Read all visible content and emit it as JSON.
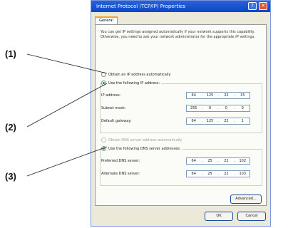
{
  "callouts": [
    "(1)",
    "(2)",
    "(3)"
  ],
  "window": {
    "title": "Internet Protocol (TCP/IP) Properties",
    "help_glyph": "?",
    "close_glyph": "✕"
  },
  "tabs": [
    {
      "label": "General"
    }
  ],
  "intro_text": "You can get IP settings assigned automatically if your network supports this capability. Otherwise, you need to ask your network administrator for the appropriate IP settings.",
  "ip_section": {
    "auto_label": "Obtain an IP address automatically",
    "manual_label": "Use the following IP address:",
    "fields": [
      {
        "label": "IP address:",
        "octets": [
          "64",
          "125",
          "22",
          "15"
        ]
      },
      {
        "label": "Subnet mask:",
        "octets": [
          "255",
          "0",
          "0",
          "0"
        ]
      },
      {
        "label": "Default gateway:",
        "octets": [
          "64",
          "125",
          "22",
          "1"
        ]
      }
    ]
  },
  "dns_section": {
    "auto_label": "Obtain DNS server address automatically",
    "manual_label": "Use the following DNS server addresses:",
    "fields": [
      {
        "label": "Preferred DNS server:",
        "octets": [
          "64",
          "25",
          "22",
          "102"
        ]
      },
      {
        "label": "Alternate DNS server:",
        "octets": [
          "64",
          "25",
          "22",
          "103"
        ]
      }
    ]
  },
  "buttons": {
    "advanced": "Advanced...",
    "ok": "OK",
    "cancel": "Cancel"
  },
  "colors": {
    "titlebar": "#0a46c8",
    "dialog_bg": "#ece9d8",
    "selected_radio": "#2a9a2a"
  }
}
